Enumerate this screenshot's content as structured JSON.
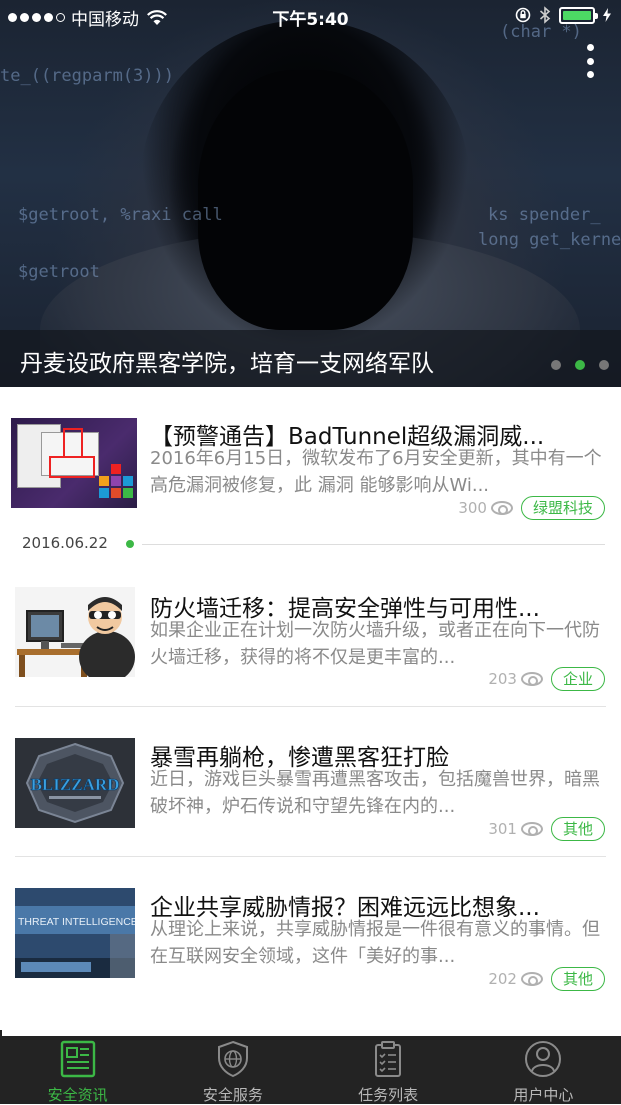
{
  "status_bar": {
    "carrier": "中国移动",
    "time": "下午5:40"
  },
  "banner": {
    "caption": "丹麦设政府黑客学院，培育一支网络军队",
    "page_count": 3,
    "active_page": 2,
    "background_code_lines": [
      "te_((regparm(3)))",
      "$getroot, %raxi call",
      "$getroot",
      "(char *)",
      "ks spender_",
      "long get_kerne"
    ]
  },
  "date_divider": "2016.06.22",
  "articles": [
    {
      "title": "【预警通告】BadTunnel超级漏洞威...",
      "desc": "2016年6月15日，微软发布了6月安全更新，其中有一个高危漏洞被修复，此 漏洞 能够影响从Wi...",
      "views": "300",
      "tag": "绿盟科技",
      "thumb": "windows-screenshot"
    },
    {
      "title": "防火墙迁移：提高安全弹性与可用性...",
      "desc": "如果企业正在计划一次防火墙升级，或者正在向下一代防火墙迁移，获得的将不仅是更丰富的...",
      "views": "203",
      "tag": "企业",
      "thumb": "hacker-cartoon"
    },
    {
      "title": "暴雪再躺枪，惨遭黑客狂打脸",
      "desc": "近日，游戏巨头暴雪再遭黑客攻击，包括魔兽世界，暗黑破坏神，炉石传说和守望先锋在内的...",
      "views": "301",
      "tag": "其他",
      "thumb": "blizzard-logo"
    },
    {
      "title": "企业共享威胁情报？困难远远比想象...",
      "desc": "从理论上来说，共享威胁情报是一件很有意义的事情。但在互联网安全领域，这件「美好的事...",
      "views": "202",
      "tag": "其他",
      "thumb": "threat-intelligence"
    }
  ],
  "thumb_text": {
    "blizzard": "BLIZZARD",
    "threat": "THREAT INTELLIGENCE CEN"
  },
  "tabs": [
    {
      "label": "安全资讯",
      "icon": "news-icon",
      "active": true
    },
    {
      "label": "安全服务",
      "icon": "shield-globe-icon",
      "active": false
    },
    {
      "label": "任务列表",
      "icon": "clipboard-icon",
      "active": false
    },
    {
      "label": "用户中心",
      "icon": "user-icon",
      "active": false
    }
  ],
  "colors": {
    "accent": "#3cb846",
    "tabbar_bg": "#232323",
    "muted_text": "#8a8a8a"
  }
}
